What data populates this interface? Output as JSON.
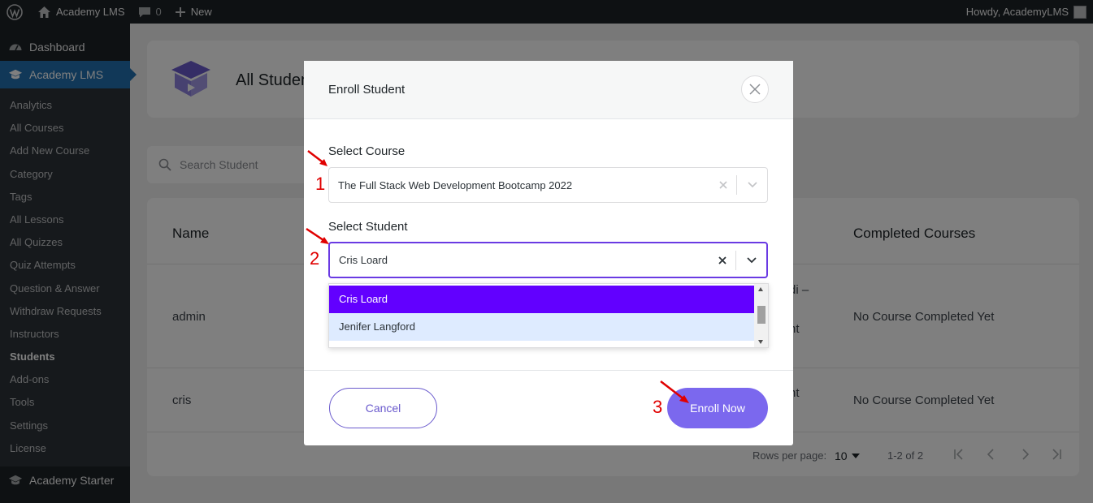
{
  "adminbar": {
    "site_name": "Academy LMS",
    "comments_count": "0",
    "new_label": "New",
    "howdy": "Howdy, AcademyLMS"
  },
  "sidebar": {
    "dashboard": "Dashboard",
    "academy": "Academy LMS",
    "items": [
      {
        "label": "Analytics"
      },
      {
        "label": "All Courses"
      },
      {
        "label": "Add New Course"
      },
      {
        "label": "Category"
      },
      {
        "label": "Tags"
      },
      {
        "label": "All Lessons"
      },
      {
        "label": "All Quizzes"
      },
      {
        "label": "Quiz Attempts"
      },
      {
        "label": "Question & Answer"
      },
      {
        "label": "Withdraw Requests"
      },
      {
        "label": "Instructors"
      },
      {
        "label": "Students"
      },
      {
        "label": "Add-ons"
      },
      {
        "label": "Tools"
      },
      {
        "label": "Settings"
      },
      {
        "label": "License"
      }
    ],
    "starter": "Academy Starter"
  },
  "page": {
    "title": "All Students",
    "search_placeholder": "Search Student",
    "columns": {
      "name": "Name",
      "completed": "Completed Courses"
    },
    "rows": [
      {
        "name": "admin",
        "course_partial_1": "di –",
        "course_partial_2": "nt",
        "completed": "No Course Completed Yet"
      },
      {
        "name": "cris",
        "course_partial": "nt",
        "completed": "No Course Completed Yet"
      }
    ],
    "pagination": {
      "rows_per_page_label": "Rows per page:",
      "rows_per_page_value": "10",
      "range": "1-2 of 2"
    }
  },
  "modal": {
    "title": "Enroll Student",
    "course_label": "Select Course",
    "course_value": "The Full Stack Web Development Bootcamp 2022",
    "student_label": "Select Student",
    "student_value": "Cris Loard",
    "options": [
      {
        "label": "Cris Loard",
        "state": "selected"
      },
      {
        "label": "Jenifer Langford",
        "state": "hover"
      }
    ],
    "cancel_label": "Cancel",
    "enroll_label": "Enroll Now"
  },
  "annotations": {
    "step1": "1",
    "step2": "2",
    "step3": "3",
    "color": "#e00000"
  },
  "colors": {
    "wp_dark": "#1d2327",
    "wp_blue": "#2271b1",
    "accent_purple": "#7b68ee",
    "option_selected": "#6200ff",
    "option_hover": "#deebff"
  }
}
